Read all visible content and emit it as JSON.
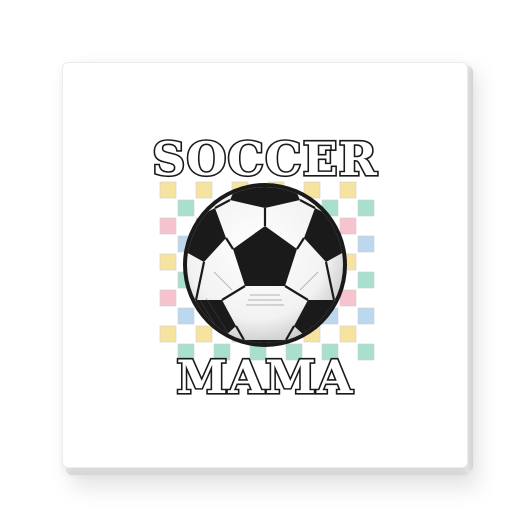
{
  "artwork": {
    "top_text": "SOCCER",
    "bottom_text": "MAMA",
    "ball_icon": "soccer-ball",
    "checker_colors": [
      "#f7e3a0",
      "#a9dfcf",
      "#f6c3cf",
      "#bcd8ee",
      "#ffffff"
    ]
  }
}
